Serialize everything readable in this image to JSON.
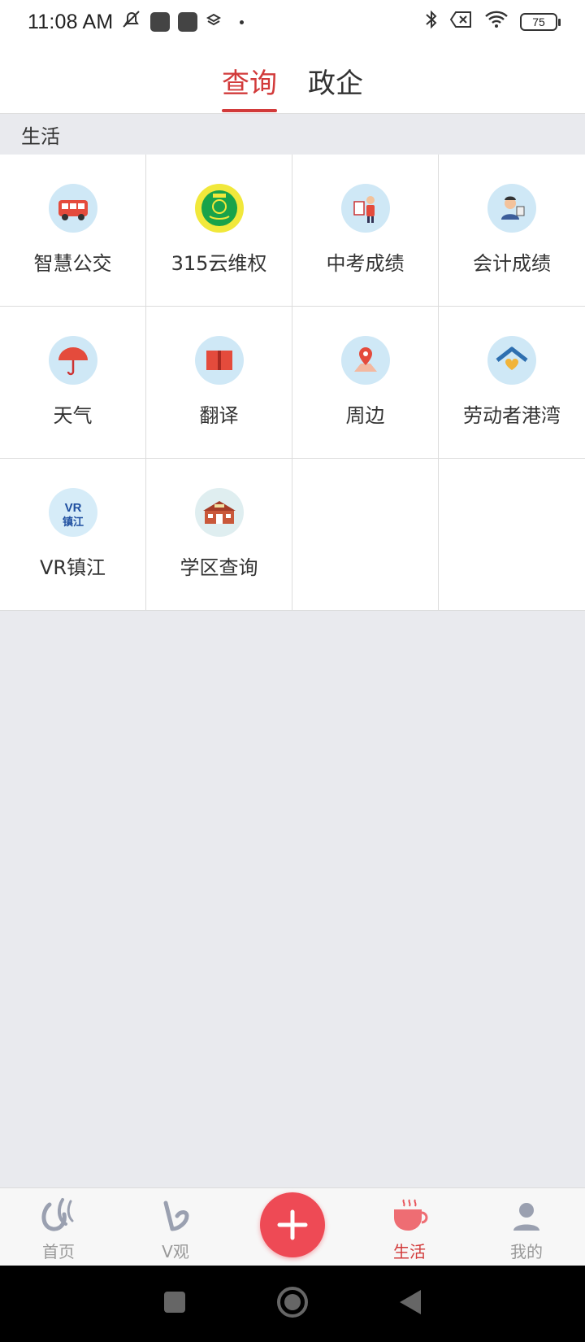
{
  "status_bar": {
    "time": "11:08 AM",
    "battery": "75",
    "icons": [
      "mute-icon",
      "app-icon",
      "app-icon",
      "layers-icon",
      "dot-icon",
      "bluetooth-icon",
      "sim-off-icon",
      "wifi-icon",
      "battery-icon"
    ]
  },
  "top_tabs": [
    {
      "label": "查询",
      "active": true
    },
    {
      "label": "政企",
      "active": false
    }
  ],
  "section": {
    "title": "生活"
  },
  "grid_items": [
    {
      "label": "智慧公交",
      "icon": "bus-icon"
    },
    {
      "label": "315云维权",
      "icon": "rights-badge-icon"
    },
    {
      "label": "中考成绩",
      "icon": "exam-score-icon"
    },
    {
      "label": "会计成绩",
      "icon": "accountant-icon"
    },
    {
      "label": "天气",
      "icon": "umbrella-icon"
    },
    {
      "label": "翻译",
      "icon": "book-icon"
    },
    {
      "label": "周边",
      "icon": "map-pin-icon"
    },
    {
      "label": "劳动者港湾",
      "icon": "home-heart-icon"
    },
    {
      "label": "VR镇江",
      "icon": "vr-zhenjiang-icon",
      "icon_text": "VR\n镇江"
    },
    {
      "label": "学区查询",
      "icon": "school-icon"
    }
  ],
  "bottom_nav": [
    {
      "label": "首页",
      "icon": "home-logo-icon",
      "active": false
    },
    {
      "label": "V观",
      "icon": "v-icon",
      "active": false
    },
    {
      "label": "",
      "icon": "plus-icon",
      "active": false
    },
    {
      "label": "生活",
      "icon": "cup-icon",
      "active": true
    },
    {
      "label": "我的",
      "icon": "user-icon",
      "active": false
    }
  ],
  "colors": {
    "accent": "#d23a3a",
    "background": "#e9eaee",
    "add_button": "#ee4a55",
    "icon_bg": "#cfe8f6"
  }
}
